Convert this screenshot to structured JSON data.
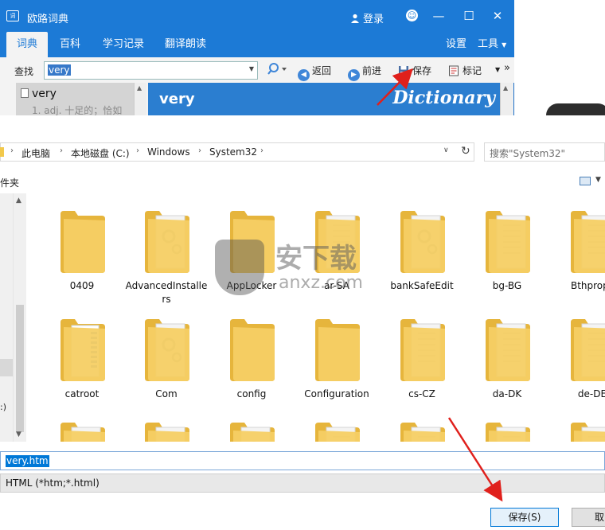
{
  "dict": {
    "app_icon": "词",
    "title": "欧路词典",
    "login": "登录",
    "tabs": [
      "词典",
      "百科",
      "学习记录",
      "翻译朗读"
    ],
    "settings": "设置",
    "tools": "工具",
    "search_label": "查找",
    "search_value": "very",
    "back": "返回",
    "forward": "前进",
    "save": "保存",
    "bookmark": "标记",
    "more": "»",
    "list_word": "very",
    "list_def": "1. adj. 十足的；恰如",
    "panel_word": "very",
    "panel_brand": "Dictionary",
    "icons": [
      "dictionary-app-icon",
      "user-icon",
      "smile-icon",
      "minimize-icon",
      "maximize-icon",
      "close-icon",
      "magnifier-icon",
      "back-icon",
      "forward-icon",
      "save-disk-icon",
      "bookmark-icon"
    ]
  },
  "save_dialog": {
    "breadcrumb": [
      "此电脑",
      "本地磁盘 (C:)",
      "Windows",
      "System32"
    ],
    "search_placeholder": "搜索\"System32\"",
    "folder_label": "件夹",
    "nav_label": ":)",
    "files": [
      {
        "name": "0409",
        "type": "plain"
      },
      {
        "name": "AdvancedInstallers",
        "type": "gear"
      },
      {
        "name": "AppLocker",
        "type": "plain"
      },
      {
        "name": "ar-SA",
        "type": "doc"
      },
      {
        "name": "bankSafeEdit",
        "type": "gear"
      },
      {
        "name": "bg-BG",
        "type": "doc"
      },
      {
        "name": "Bthprops",
        "type": "doc"
      },
      {
        "name": "catroot",
        "type": "blue"
      },
      {
        "name": "Com",
        "type": "gear"
      },
      {
        "name": "config",
        "type": "plain"
      },
      {
        "name": "Configuration",
        "type": "plain"
      },
      {
        "name": "cs-CZ",
        "type": "doc"
      },
      {
        "name": "da-DK",
        "type": "doc"
      },
      {
        "name": "de-DE",
        "type": "doc"
      },
      {
        "name": "",
        "type": "gear"
      },
      {
        "name": "",
        "type": "gear"
      },
      {
        "name": "",
        "type": "gear"
      },
      {
        "name": "",
        "type": "doc"
      },
      {
        "name": "",
        "type": "doc"
      },
      {
        "name": "",
        "type": "doc"
      },
      {
        "name": "",
        "type": "doc"
      }
    ],
    "filename": "very.htm",
    "filetype": "HTML (*htm;*.html)",
    "save_button": "保存(S)",
    "cancel_button": "取"
  },
  "watermark": {
    "name": "安下载",
    "url": "anxz.com"
  },
  "colors": {
    "accent": "#1c7ad6",
    "folder": "#f5cf64",
    "arrow": "#e0201c"
  }
}
